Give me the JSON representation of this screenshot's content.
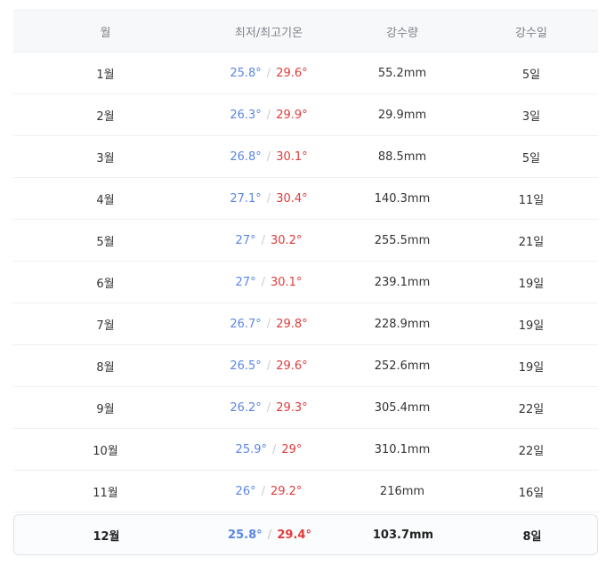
{
  "table": {
    "headers": [
      "월",
      "최저/최고기온",
      "강수량",
      "강수일"
    ],
    "temp_separator": "/",
    "rows": [
      {
        "month": "1월",
        "min": "25.8°",
        "max": "29.6°",
        "precip": "55.2mm",
        "days": "5일"
      },
      {
        "month": "2월",
        "min": "26.3°",
        "max": "29.9°",
        "precip": "29.9mm",
        "days": "3일"
      },
      {
        "month": "3월",
        "min": "26.8°",
        "max": "30.1°",
        "precip": "88.5mm",
        "days": "5일"
      },
      {
        "month": "4월",
        "min": "27.1°",
        "max": "30.4°",
        "precip": "140.3mm",
        "days": "11일"
      },
      {
        "month": "5월",
        "min": "27°",
        "max": "30.2°",
        "precip": "255.5mm",
        "days": "21일"
      },
      {
        "month": "6월",
        "min": "27°",
        "max": "30.1°",
        "precip": "239.1mm",
        "days": "19일"
      },
      {
        "month": "7월",
        "min": "26.7°",
        "max": "29.8°",
        "precip": "228.9mm",
        "days": "19일"
      },
      {
        "month": "8월",
        "min": "26.5°",
        "max": "29.6°",
        "precip": "252.6mm",
        "days": "19일"
      },
      {
        "month": "9월",
        "min": "26.2°",
        "max": "29.3°",
        "precip": "305.4mm",
        "days": "22일"
      },
      {
        "month": "10월",
        "min": "25.9°",
        "max": "29°",
        "precip": "310.1mm",
        "days": "22일"
      },
      {
        "month": "11월",
        "min": "26°",
        "max": "29.2°",
        "precip": "216mm",
        "days": "16일"
      },
      {
        "month": "12월",
        "min": "25.8°",
        "max": "29.4°",
        "precip": "103.7mm",
        "days": "8일"
      }
    ]
  },
  "colors": {
    "min_temp": "#5b86e5",
    "max_temp": "#e03b3b",
    "header_bg": "#f7f8fa"
  }
}
